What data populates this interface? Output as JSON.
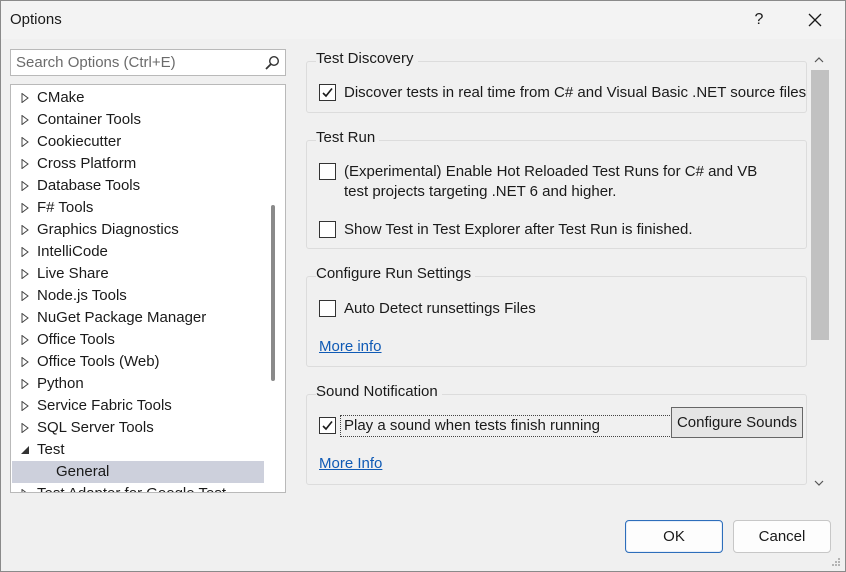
{
  "window": {
    "title": "Options",
    "help_label": "?"
  },
  "search": {
    "placeholder": "Search Options (Ctrl+E)"
  },
  "tree": {
    "items": [
      {
        "label": "CMake",
        "state": "collapsed"
      },
      {
        "label": "Container Tools",
        "state": "collapsed"
      },
      {
        "label": "Cookiecutter",
        "state": "collapsed"
      },
      {
        "label": "Cross Platform",
        "state": "collapsed"
      },
      {
        "label": "Database Tools",
        "state": "collapsed"
      },
      {
        "label": "F# Tools",
        "state": "collapsed"
      },
      {
        "label": "Graphics Diagnostics",
        "state": "collapsed"
      },
      {
        "label": "IntelliCode",
        "state": "collapsed"
      },
      {
        "label": "Live Share",
        "state": "collapsed"
      },
      {
        "label": "Node.js Tools",
        "state": "collapsed"
      },
      {
        "label": "NuGet Package Manager",
        "state": "collapsed"
      },
      {
        "label": "Office Tools",
        "state": "collapsed"
      },
      {
        "label": "Office Tools (Web)",
        "state": "collapsed"
      },
      {
        "label": "Python",
        "state": "collapsed"
      },
      {
        "label": "Service Fabric Tools",
        "state": "collapsed"
      },
      {
        "label": "SQL Server Tools",
        "state": "collapsed"
      },
      {
        "label": "Test",
        "state": "expanded"
      },
      {
        "label": "General",
        "state": "child-selected"
      },
      {
        "label": "Test Adapter for Google Test",
        "state": "collapsed"
      }
    ]
  },
  "groups": {
    "discovery": {
      "title": "Test Discovery",
      "realtime": {
        "label": "Discover tests in real time from C# and Visual Basic .NET source files",
        "checked": true
      }
    },
    "run": {
      "title": "Test Run",
      "hot_reload": {
        "label": "(Experimental) Enable Hot Reloaded Test Runs for C# and VB test projects targeting .NET 6 and higher.",
        "checked": false
      },
      "show_test": {
        "label": "Show Test in Test Explorer after Test Run is finished.",
        "checked": false
      }
    },
    "run_settings": {
      "title": "Configure Run Settings",
      "auto_detect": {
        "label": "Auto Detect runsettings Files",
        "checked": false
      },
      "more_info": "More info"
    },
    "sound": {
      "title": "Sound Notification",
      "play_sound": {
        "label": "Play a sound when tests finish running",
        "checked": true
      },
      "configure_sounds": "Configure Sounds",
      "more_info": "More Info"
    }
  },
  "footer": {
    "ok_label": "OK",
    "cancel_label": "Cancel"
  },
  "colors": {
    "link": "#0f5ab5",
    "selected_row": "#cdd0dc",
    "default_button_border": "#2d6ebb"
  }
}
